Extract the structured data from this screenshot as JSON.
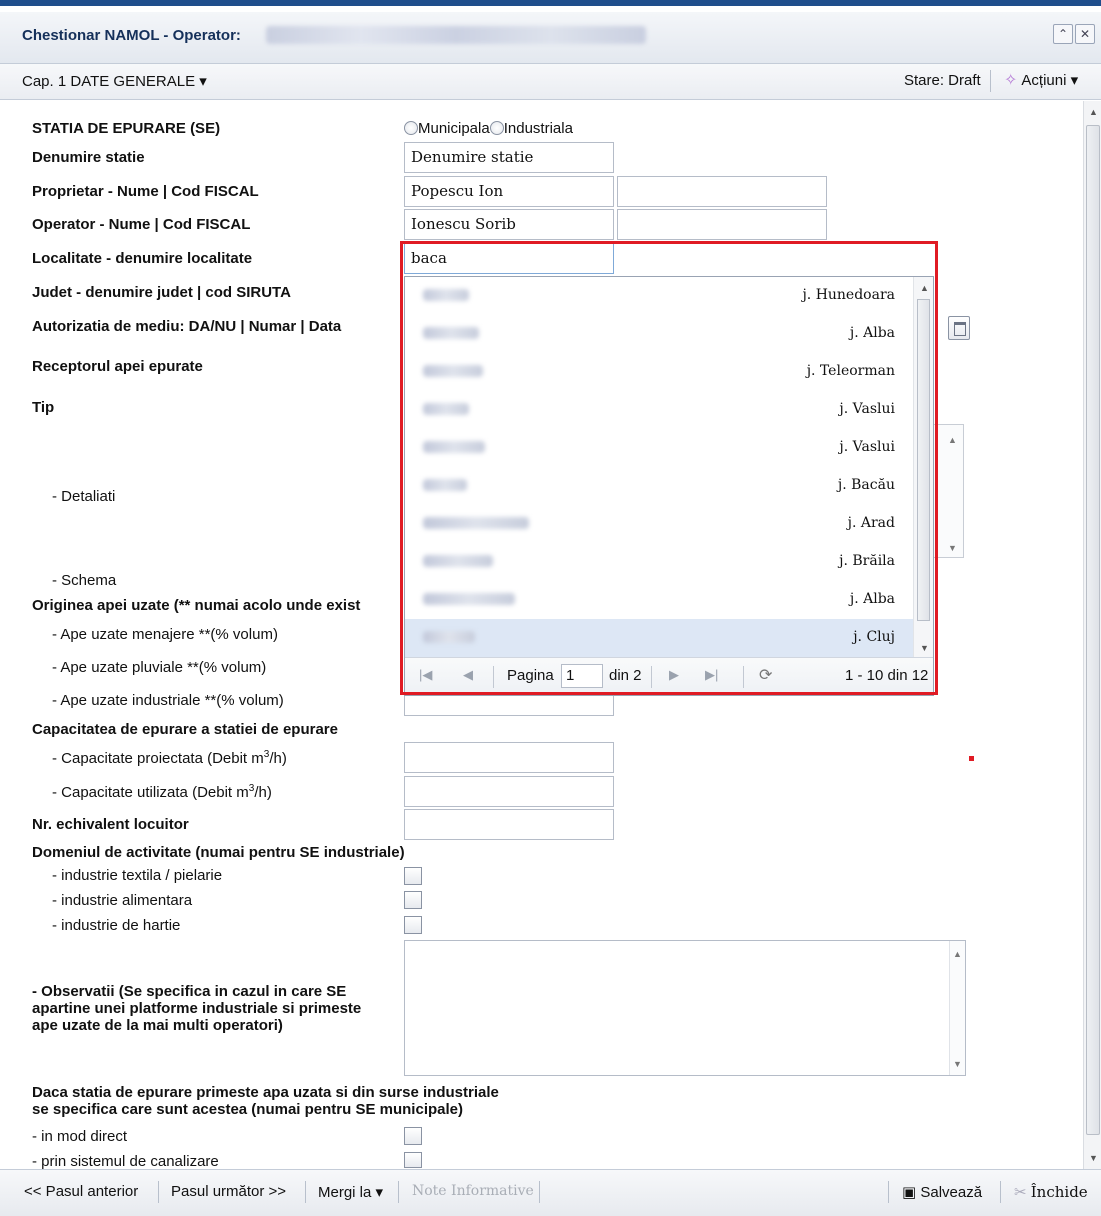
{
  "window": {
    "title": "Chestionar NAMOL - Operator:",
    "chapter": "Cap. 1 DATE GENERALE",
    "chapter_caret": "▾",
    "state": "Stare: Draft",
    "actions": "Acțiuni",
    "actions_caret": "▾"
  },
  "form": {
    "se_label": "STATIA DE EPURARE (SE)",
    "radio_municipal": "Municipala",
    "radio_industrial": "Industriala",
    "denumire_label": "Denumire statie",
    "denumire_value": "Denumire statie",
    "proprietar_label": "Proprietar - Nume | Cod FISCAL",
    "proprietar_value": "Popescu Ion",
    "operator_label": "Operator - Nume | Cod FISCAL",
    "operator_value": "Ionescu Sorib",
    "localitate_label": "Localitate - denumire localitate",
    "localitate_value": "baca",
    "judet_label": "Judet - denumire judet | cod SIRUTA",
    "autorizatie_label": "Autorizatia de mediu: DA/NU | Numar | Data",
    "receptor_label": "Receptorul apei epurate",
    "tip_label": "Tip",
    "detaliati_label": "- Detaliati",
    "schema_label": "- Schema",
    "originea_label": "Originea apei uzate (** numai acolo unde exist",
    "menajere_label": "- Ape uzate menajere **(% volum)",
    "pluviale_label": "- Ape uzate pluviale **(% volum)",
    "industriale_label": "- Ape uzate industriale **(% volum)",
    "capacitate_label": "Capacitatea de epurare a statiei de epurare",
    "cap_proiectata_label": "- Capacitate proiectata (Debit m",
    "cap_utilizata_label": "- Capacitate utilizata (Debit m",
    "unit_sup": "3",
    "unit_tail": "/h)",
    "echivalent_label": "Nr. echivalent locuitor",
    "domeniu_label": "Domeniul de activitate (numai pentru SE industriale)",
    "textila_label": "- industrie textila / pielarie",
    "alimentara_label": "- industrie alimentara",
    "hartie_label": "- industrie de hartie",
    "observatii_line1": "- Observatii (Se specifica in cazul in care SE",
    "observatii_line2": "apartine unei platforme industriale si primeste",
    "observatii_line3": "ape uzate de la mai multi operatori)",
    "surse_line1": "Daca statia de epurare primeste apa uzata si din surse industriale",
    "surse_line2": "se specifica care sunt acestea (numai pentru SE municipale)",
    "direct_label": "- in mod direct",
    "canalizare_label": "- prin sistemul de canalizare"
  },
  "dropdown": {
    "items": [
      {
        "county": "j. Hunedoara"
      },
      {
        "county": "j. Alba"
      },
      {
        "county": "j. Teleorman"
      },
      {
        "county": "j. Vaslui"
      },
      {
        "county": "j. Vaslui"
      },
      {
        "county": "j. Bacău"
      },
      {
        "county": "j. Arad"
      },
      {
        "county": "j. Brăila"
      },
      {
        "county": "j. Alba"
      },
      {
        "county": "j. Cluj"
      }
    ],
    "pager": {
      "page_label": "Pagina",
      "page_value": "1",
      "of_label": "din 2",
      "summary": "1 - 10 din 12"
    }
  },
  "bottombar": {
    "prev": "<< Pasul anterior",
    "next": "Pasul următor >>",
    "goto": "Mergi la",
    "goto_caret": "▾",
    "notes": "Note Informative",
    "save": "Salvează",
    "close": "Închide"
  },
  "colors": {
    "accent": "#1f4e8c",
    "highlight": "#e01b24",
    "selected_row": "#dde7f5"
  }
}
